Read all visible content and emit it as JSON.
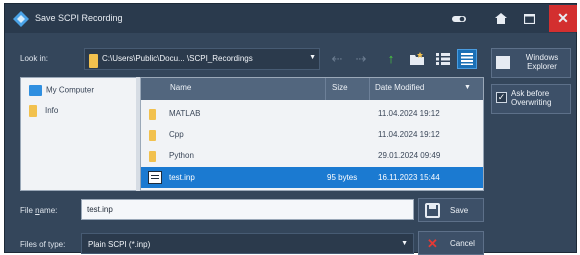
{
  "window": {
    "title": "Save SCPI Recording",
    "app_icon": "diamond-logo-icon",
    "buttons": {
      "help": "toggle-icon",
      "home": "home-icon",
      "maximize": "maximize-icon",
      "close": "close-icon"
    }
  },
  "lookin": {
    "label": "Look in:",
    "path": "C:\\Users\\Public\\Docu...        \\SCPI_Recordings",
    "icons": [
      "back-arrow-icon",
      "forward-arrow-icon",
      "up-folder-icon",
      "new-folder-icon",
      "list-view-icon",
      "details-view-icon"
    ]
  },
  "places": [
    {
      "label": "My Computer",
      "icon": "computer-icon"
    },
    {
      "label": "Info",
      "icon": "folder-icon"
    }
  ],
  "filelist": {
    "columns": {
      "name": "Name",
      "size": "Size",
      "date": "Date Modified"
    },
    "rows": [
      {
        "name": "MATLAB",
        "size": "",
        "date": "11.04.2024 19:12",
        "type": "folder",
        "selected": false
      },
      {
        "name": "Cpp",
        "size": "",
        "date": "11.04.2024 19:12",
        "type": "folder",
        "selected": false
      },
      {
        "name": "Python",
        "size": "",
        "date": "29.01.2024 09:49",
        "type": "folder",
        "selected": false
      },
      {
        "name": "test.inp",
        "size": "95 bytes",
        "date": "16.11.2023 15:44",
        "type": "file",
        "selected": true
      }
    ]
  },
  "right_panel": {
    "windows_explorer": "Windows Explorer",
    "ask_before_overwriting": "Ask before Overwriting",
    "ask_checked": true
  },
  "form": {
    "file_name_label_prefix": "File ",
    "file_name_label_underlined": "n",
    "file_name_label_suffix": "ame:",
    "file_name_value": "test.inp",
    "file_type_label": "Files of type:",
    "file_type_value": "Plain SCPI (*.inp)",
    "save_label": "Save",
    "cancel_label": "Cancel"
  },
  "colors": {
    "dialog_bg": "#34465b",
    "titlebar_bg": "#2a3a4d",
    "selection": "#1b7ad1",
    "close_red": "#d32f2f",
    "folder_yellow": "#f2c14e",
    "up_arrow_green": "#4cd23d"
  }
}
